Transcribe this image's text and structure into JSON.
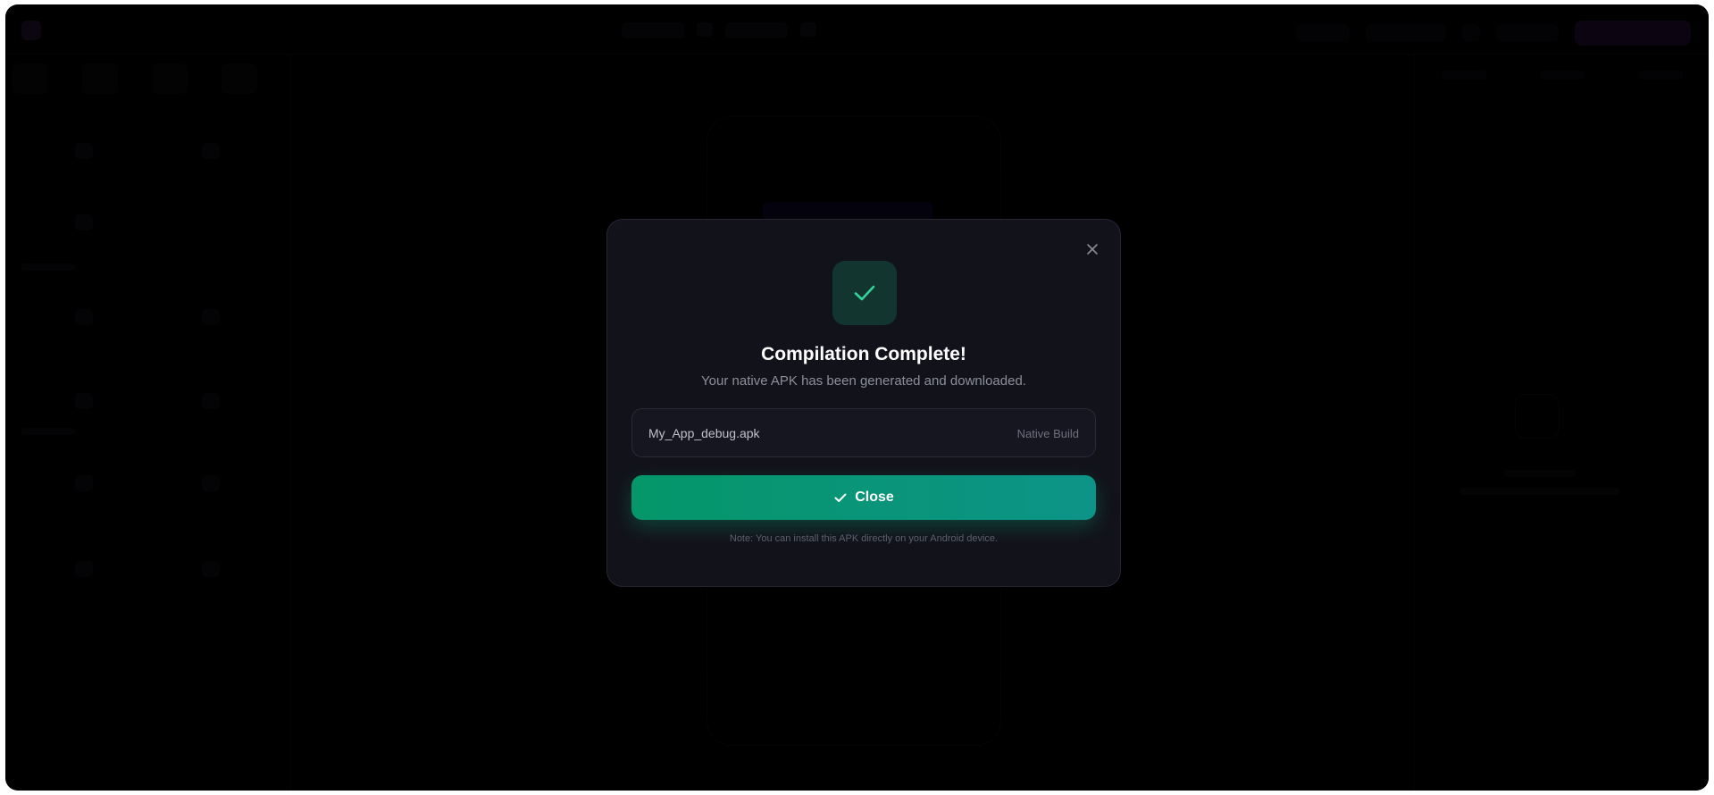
{
  "modal": {
    "title": "Compilation Complete!",
    "subtitle": "Your native APK has been generated and downloaded.",
    "file": {
      "name": "My_App_debug.apk",
      "tag": "Native Build"
    },
    "close_button_label": "Close",
    "note": "Note: You can install this APK directly on your Android device.",
    "icons": {
      "success": "check-icon",
      "dismiss": "close-icon",
      "button": "check-icon"
    }
  },
  "colors": {
    "accent_green_start": "#059669",
    "accent_green_end": "#0d9488",
    "success_badge_bg": "#12352f",
    "check_color": "#34d399",
    "modal_bg": "#12121b"
  }
}
